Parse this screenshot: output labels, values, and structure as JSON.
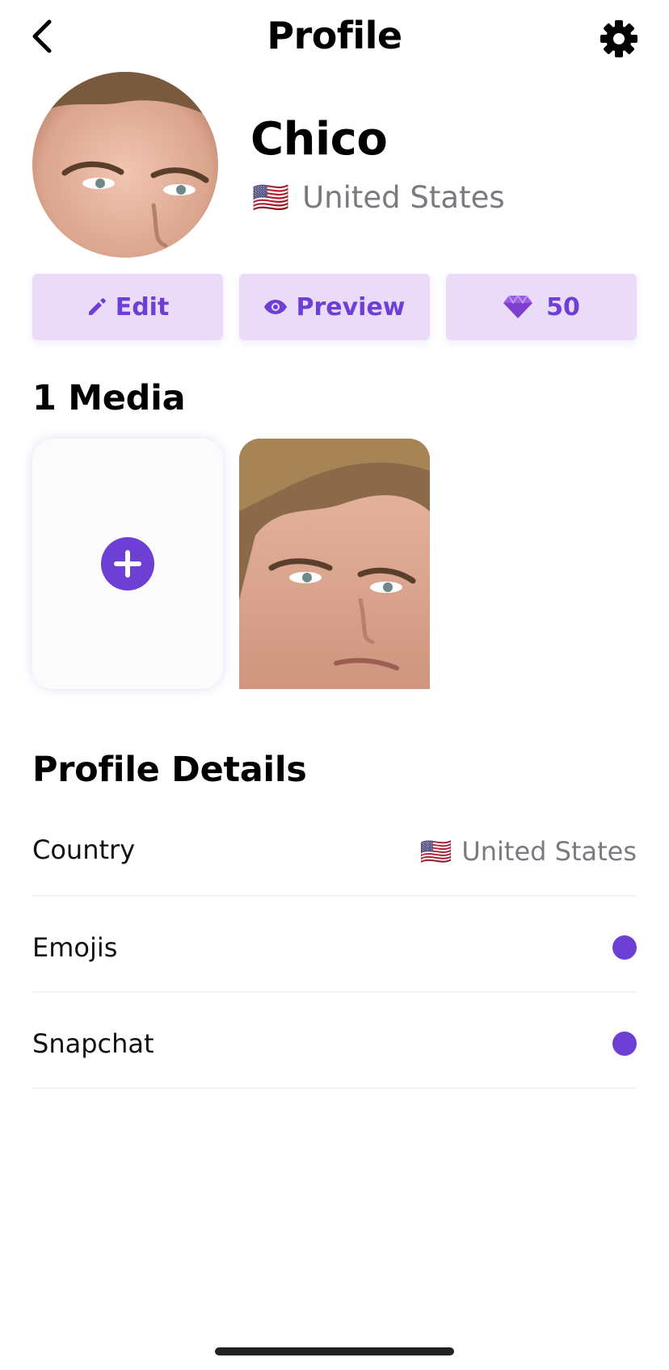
{
  "header": {
    "title": "Profile",
    "back_icon": "chevron-left-icon",
    "settings_icon": "gear-icon"
  },
  "profile": {
    "name": "Chico",
    "country": "United States",
    "flag": "🇺🇸"
  },
  "actions": {
    "edit_label": "Edit",
    "edit_icon": "pencil-icon",
    "preview_label": "Preview",
    "preview_icon": "eye-icon",
    "gems_count": "50",
    "gems_icon": "diamond-icon"
  },
  "media": {
    "title": "1 Media",
    "add_icon": "plus-icon"
  },
  "details": {
    "title": "Profile Details",
    "rows": [
      {
        "label": "Country",
        "value": "United States",
        "flag": "🇺🇸"
      },
      {
        "label": "Emojis"
      },
      {
        "label": "Snapchat"
      }
    ]
  },
  "colors": {
    "accent": "#6d3fd4",
    "button_bg": "#eadcf8",
    "muted_text": "#7a7a80"
  }
}
